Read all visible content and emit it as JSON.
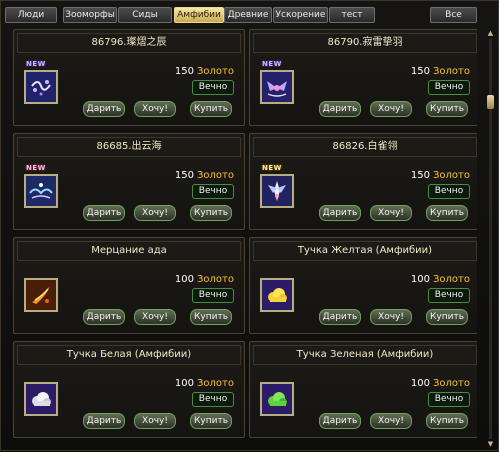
{
  "tabs": [
    {
      "label": "Люди",
      "active": false
    },
    {
      "label": "Зооморфы",
      "active": false
    },
    {
      "label": "Сиды",
      "active": false
    },
    {
      "label": "Амфибии",
      "active": true
    },
    {
      "label": "Древние",
      "active": false
    },
    {
      "label": "Ускорение",
      "active": false
    },
    {
      "label": "тест",
      "active": false
    }
  ],
  "all_tab": "Все",
  "badge_text": "NEW",
  "buttons": {
    "gift": "Дарить",
    "want": "Хочу!",
    "buy": "Купить"
  },
  "items": [
    {
      "title": "86796.璨熠之辰",
      "price": "150",
      "currency": "Золото",
      "duration": "Вечно",
      "is_new": true,
      "icon": "purple-sparkle-icon",
      "badge_color": "#c7b3ff"
    },
    {
      "title": "86790.寂雷挚羽",
      "price": "150",
      "currency": "Золото",
      "duration": "Вечно",
      "is_new": true,
      "icon": "purple-wings-icon",
      "badge_color": "#c7b3ff"
    },
    {
      "title": "86685.出云海",
      "price": "150",
      "currency": "Золото",
      "duration": "Вечно",
      "is_new": true,
      "icon": "cloud-sea-icon",
      "badge_color": "#ffb8d8"
    },
    {
      "title": "86826.白雀翎",
      "price": "150",
      "currency": "Золото",
      "duration": "Вечно",
      "is_new": true,
      "icon": "white-feather-icon",
      "badge_color": "#ffe79a"
    },
    {
      "title": "Мерцание ада",
      "price": "100",
      "currency": "Золото",
      "duration": "Вечно",
      "is_new": false,
      "icon": "fire-claw-icon"
    },
    {
      "title": "Тучка Желтая (Амфибии)",
      "price": "100",
      "currency": "Золото",
      "duration": "Вечно",
      "is_new": false,
      "icon": "yellow-cloud-icon"
    },
    {
      "title": "Тучка Белая (Амфибии)",
      "price": "100",
      "currency": "Золото",
      "duration": "Вечно",
      "is_new": false,
      "icon": "white-cloud-icon"
    },
    {
      "title": "Тучка Зеленая (Амфибии)",
      "price": "100",
      "currency": "Золото",
      "duration": "Вечно",
      "is_new": false,
      "icon": "green-cloud-icon"
    }
  ]
}
